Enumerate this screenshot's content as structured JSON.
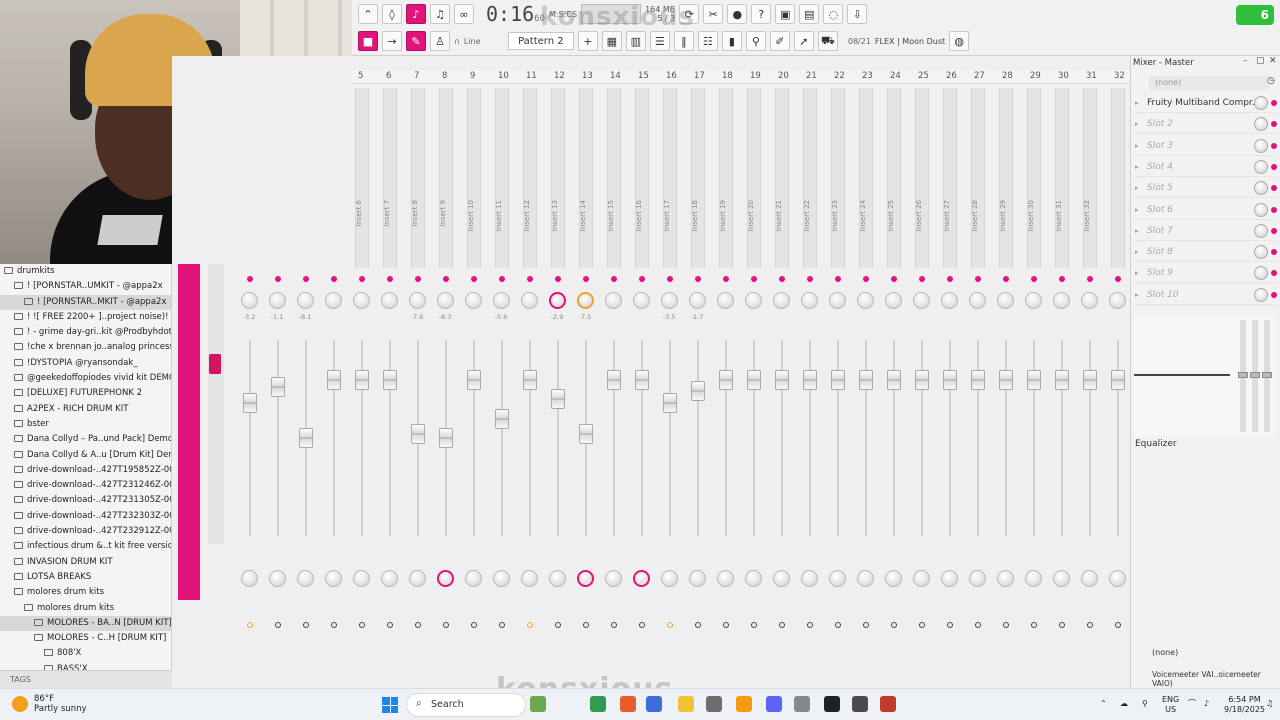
{
  "toolbar": {
    "time": "0:16",
    "time_sub": "60",
    "time_unit": "M:S:CS",
    "snap": "Line",
    "pattern": "Pattern 2",
    "memory": "164 MB",
    "cpu_a": "5",
    "cpu_b": "3",
    "hint_index": "08/21",
    "hint_text": "FLEX | Moon Dust",
    "notif_count": "6"
  },
  "watermark": "konsxious",
  "browser": {
    "items": [
      {
        "label": "drumkits",
        "indent": 0,
        "folder": true,
        "sel": false
      },
      {
        "label": "!  [PORNSTAR..UMKIT - @appa2x",
        "indent": 1,
        "folder": true,
        "sel": false
      },
      {
        "label": "!  [PORNSTAR..MKIT - @appa2x",
        "indent": 2,
        "folder": true,
        "sel": true
      },
      {
        "label": "! ![ FREE 2200+ ]..project noise)! !",
        "indent": 1,
        "folder": true,
        "sel": false
      },
      {
        "label": "! - grime day-gri..kit @Prodbyhdotty",
        "indent": 1,
        "folder": true,
        "sel": false
      },
      {
        "label": "!che x brennan jo..analog princess)",
        "indent": 1,
        "folder": true,
        "sel": false
      },
      {
        "label": "!DYSTOPIA @ryansondak_",
        "indent": 1,
        "folder": true,
        "sel": false
      },
      {
        "label": "@geekedoffopiodes vivid kit DEMO",
        "indent": 1,
        "folder": true,
        "sel": false
      },
      {
        "label": "[DELUXE] FUTUREPHONK 2",
        "indent": 1,
        "folder": true,
        "sel": false
      },
      {
        "label": "A2PEX - RICH DRUM KIT",
        "indent": 1,
        "folder": true,
        "sel": false
      },
      {
        "label": "bster",
        "indent": 1,
        "folder": true,
        "sel": false
      },
      {
        "label": "Dana Collyd – Pa..und Pack] Demo",
        "indent": 1,
        "folder": true,
        "sel": false
      },
      {
        "label": "Dana Collyd & A..u [Drum Kit] Demo",
        "indent": 1,
        "folder": true,
        "sel": false
      },
      {
        "label": "drive-download-..427T195852Z-001",
        "indent": 1,
        "folder": true,
        "sel": false
      },
      {
        "label": "drive-download-..427T231246Z-001",
        "indent": 1,
        "folder": true,
        "sel": false
      },
      {
        "label": "drive-download-..427T231305Z-001",
        "indent": 1,
        "folder": true,
        "sel": false
      },
      {
        "label": "drive-download-..427T232303Z-001",
        "indent": 1,
        "folder": true,
        "sel": false
      },
      {
        "label": "drive-download-..427T232912Z-001",
        "indent": 1,
        "folder": true,
        "sel": false
      },
      {
        "label": "infectious drum &..t kit free version",
        "indent": 1,
        "folder": true,
        "sel": false
      },
      {
        "label": "INVASION DRUM KIT",
        "indent": 1,
        "folder": true,
        "sel": false
      },
      {
        "label": "LOTSA BREAKS",
        "indent": 1,
        "folder": true,
        "sel": false
      },
      {
        "label": "molores drum kits",
        "indent": 1,
        "folder": true,
        "sel": false
      },
      {
        "label": "molores drum kits",
        "indent": 2,
        "folder": true,
        "sel": false
      },
      {
        "label": "MOLORES - BA..N [DRUM KIT]",
        "indent": 3,
        "folder": true,
        "sel": true
      },
      {
        "label": "MOLORES - C..H [DRUM KIT]",
        "indent": 3,
        "folder": true,
        "sel": false
      },
      {
        "label": "808'X",
        "indent": 4,
        "folder": true,
        "sel": false
      },
      {
        "label": "BASS'X",
        "indent": 4,
        "folder": true,
        "sel": false
      }
    ],
    "footer": "TAGS"
  },
  "ruler": [
    "5",
    "6",
    "7",
    "8",
    "9",
    "10",
    "11",
    "12",
    "13",
    "14",
    "15",
    "16",
    "17",
    "18",
    "19",
    "20",
    "21",
    "22",
    "23",
    "24",
    "25",
    "26",
    "27",
    "28",
    "29",
    "30",
    "31",
    "32"
  ],
  "strips": [
    {
      "name": "",
      "peak": "-3.2",
      "fader": 0.78
    },
    {
      "name": "",
      "peak": "-1.1",
      "fader": 0.86
    },
    {
      "name": "",
      "peak": "-8.1",
      "fader": 0.6
    },
    {
      "name": "",
      "peak": "",
      "fader": 0.9
    },
    {
      "name": "Insert 6",
      "peak": "",
      "fader": 0.9
    },
    {
      "name": "Insert 7",
      "peak": "",
      "fader": 0.9
    },
    {
      "name": "Insert 8",
      "peak": "-7.6",
      "fader": 0.62
    },
    {
      "name": "Insert 9",
      "peak": "-8.3",
      "fader": 0.6
    },
    {
      "name": "Insert 10",
      "peak": "",
      "fader": 0.9
    },
    {
      "name": "Insert 11",
      "peak": "-5.6",
      "fader": 0.7
    },
    {
      "name": "Insert 12",
      "peak": "",
      "fader": 0.9
    },
    {
      "name": "Insert 13",
      "peak": "-2.9",
      "fader": 0.8
    },
    {
      "name": "Insert 14",
      "peak": "-7.5",
      "fader": 0.62
    },
    {
      "name": "Insert 15",
      "peak": "",
      "fader": 0.9
    },
    {
      "name": "Insert 16",
      "peak": "",
      "fader": 0.9
    },
    {
      "name": "Insert 17",
      "peak": "-3.5",
      "fader": 0.78
    },
    {
      "name": "Insert 18",
      "peak": "-1.7",
      "fader": 0.84
    },
    {
      "name": "Insert 19",
      "peak": "",
      "fader": 0.9
    },
    {
      "name": "Insert 20",
      "peak": "",
      "fader": 0.9
    },
    {
      "name": "Insert 21",
      "peak": "",
      "fader": 0.9
    },
    {
      "name": "Insert 22",
      "peak": "",
      "fader": 0.9
    },
    {
      "name": "Insert 23",
      "peak": "",
      "fader": 0.9
    },
    {
      "name": "Insert 24",
      "peak": "",
      "fader": 0.9
    },
    {
      "name": "Insert 25",
      "peak": "",
      "fader": 0.9
    },
    {
      "name": "Insert 26",
      "peak": "",
      "fader": 0.9
    },
    {
      "name": "Insert 27",
      "peak": "",
      "fader": 0.9
    },
    {
      "name": "Insert 28",
      "peak": "",
      "fader": 0.9
    },
    {
      "name": "Insert 29",
      "peak": "",
      "fader": 0.9
    },
    {
      "name": "Insert 30",
      "peak": "",
      "fader": 0.9
    },
    {
      "name": "Insert 31",
      "peak": "",
      "fader": 0.9
    },
    {
      "name": "Insert 32",
      "peak": "",
      "fader": 0.9
    },
    {
      "name": "",
      "peak": "",
      "fader": 0.9
    },
    {
      "name": "",
      "peak": "",
      "fader": 0.9
    },
    {
      "name": "",
      "peak": "",
      "fader": 0.9
    }
  ],
  "panel": {
    "title": "Mixer - Master",
    "input": "(none)",
    "slots": [
      {
        "label": "Fruity Multiband Compr...",
        "active": true
      },
      {
        "label": "Slot 2",
        "active": false
      },
      {
        "label": "Slot 3",
        "active": false
      },
      {
        "label": "Slot 4",
        "active": false
      },
      {
        "label": "Slot 5",
        "active": false
      },
      {
        "label": "Slot 6",
        "active": false
      },
      {
        "label": "Slot 7",
        "active": false
      },
      {
        "label": "Slot 8",
        "active": false
      },
      {
        "label": "Slot 9",
        "active": false
      },
      {
        "label": "Slot 10",
        "active": false
      }
    ],
    "eq_label": "Equalizer",
    "output": "(none)",
    "device": "Voicemeeter VAI..oicemeeter VAIO)"
  },
  "taskbar": {
    "temp": "86°F",
    "weather": "Partly sunny",
    "search": "Search",
    "lang_a": "ENG",
    "lang_b": "US",
    "time": "6:54 PM",
    "date": "9/18/2025"
  }
}
